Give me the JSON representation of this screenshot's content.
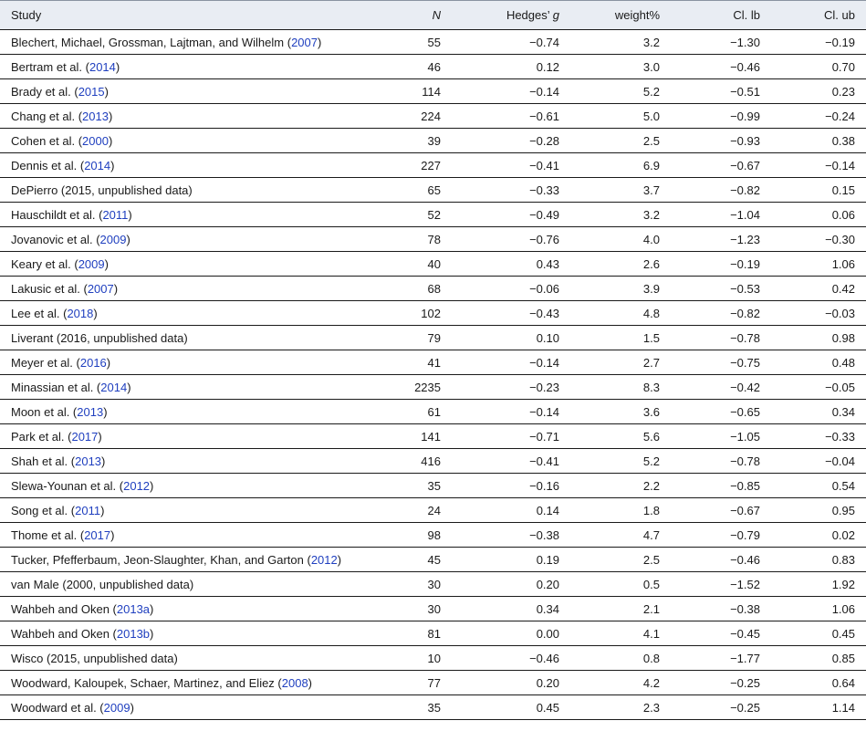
{
  "headers": {
    "study": "Study",
    "n": "N",
    "g_prefix": "Hedges’ ",
    "g_var": "g",
    "weight": "weight%",
    "cl_lb": "Cl. lb",
    "cl_ub": "Cl. ub"
  },
  "rows": [
    {
      "pre": "Blechert, Michael, Grossman, Lajtman, and Wilhelm (",
      "cite": "2007",
      "post": ")",
      "n": "55",
      "g": "−0.74",
      "w": "3.2",
      "lb": "−1.30",
      "ub": "−0.19"
    },
    {
      "pre": "Bertram et al. (",
      "cite": "2014",
      "post": ")",
      "n": "46",
      "g": "0.12",
      "w": "3.0",
      "lb": "−0.46",
      "ub": "0.70"
    },
    {
      "pre": "Brady et al. (",
      "cite": "2015",
      "post": ")",
      "n": "114",
      "g": "−0.14",
      "w": "5.2",
      "lb": "−0.51",
      "ub": "0.23"
    },
    {
      "pre": "Chang et al. (",
      "cite": "2013",
      "post": ")",
      "n": "224",
      "g": "−0.61",
      "w": "5.0",
      "lb": "−0.99",
      "ub": "−0.24"
    },
    {
      "pre": "Cohen et al. (",
      "cite": "2000",
      "post": ")",
      "n": "39",
      "g": "−0.28",
      "w": "2.5",
      "lb": "−0.93",
      "ub": "0.38"
    },
    {
      "pre": "Dennis et al. (",
      "cite": "2014",
      "post": ")",
      "n": "227",
      "g": "−0.41",
      "w": "6.9",
      "lb": "−0.67",
      "ub": "−0.14"
    },
    {
      "pre": "DePierro (2015, unpublished data)",
      "cite": "",
      "post": "",
      "n": "65",
      "g": "−0.33",
      "w": "3.7",
      "lb": "−0.82",
      "ub": "0.15"
    },
    {
      "pre": "Hauschildt et al. (",
      "cite": "2011",
      "post": ")",
      "n": "52",
      "g": "−0.49",
      "w": "3.2",
      "lb": "−1.04",
      "ub": "0.06"
    },
    {
      "pre": "Jovanovic et al. (",
      "cite": "2009",
      "post": ")",
      "n": "78",
      "g": "−0.76",
      "w": "4.0",
      "lb": "−1.23",
      "ub": "−0.30"
    },
    {
      "pre": "Keary et al. (",
      "cite": "2009",
      "post": ")",
      "n": "40",
      "g": "0.43",
      "w": "2.6",
      "lb": "−0.19",
      "ub": "1.06"
    },
    {
      "pre": "Lakusic et al. (",
      "cite": "2007",
      "post": ")",
      "n": "68",
      "g": "−0.06",
      "w": "3.9",
      "lb": "−0.53",
      "ub": "0.42"
    },
    {
      "pre": "Lee et al. (",
      "cite": "2018",
      "post": ")",
      "n": "102",
      "g": "−0.43",
      "w": "4.8",
      "lb": "−0.82",
      "ub": "−0.03"
    },
    {
      "pre": "Liverant (2016, unpublished data)",
      "cite": "",
      "post": "",
      "n": "79",
      "g": "0.10",
      "w": "1.5",
      "lb": "−0.78",
      "ub": "0.98"
    },
    {
      "pre": "Meyer et al. (",
      "cite": "2016",
      "post": ")",
      "n": "41",
      "g": "−0.14",
      "w": "2.7",
      "lb": "−0.75",
      "ub": "0.48"
    },
    {
      "pre": "Minassian et al. (",
      "cite": "2014",
      "post": ")",
      "n": "2235",
      "g": "−0.23",
      "w": "8.3",
      "lb": "−0.42",
      "ub": "−0.05"
    },
    {
      "pre": "Moon et al. (",
      "cite": "2013",
      "post": ")",
      "n": "61",
      "g": "−0.14",
      "w": "3.6",
      "lb": "−0.65",
      "ub": "0.34"
    },
    {
      "pre": "Park et al. (",
      "cite": "2017",
      "post": ")",
      "n": "141",
      "g": "−0.71",
      "w": "5.6",
      "lb": "−1.05",
      "ub": "−0.33"
    },
    {
      "pre": "Shah et al. (",
      "cite": "2013",
      "post": ")",
      "n": "416",
      "g": "−0.41",
      "w": "5.2",
      "lb": "−0.78",
      "ub": "−0.04"
    },
    {
      "pre": "Slewa-Younan et al. (",
      "cite": "2012",
      "post": ")",
      "n": "35",
      "g": "−0.16",
      "w": "2.2",
      "lb": "−0.85",
      "ub": "0.54"
    },
    {
      "pre": "Song et al. (",
      "cite": "2011",
      "post": ")",
      "n": "24",
      "g": "0.14",
      "w": "1.8",
      "lb": "−0.67",
      "ub": "0.95"
    },
    {
      "pre": "Thome et al. (",
      "cite": "2017",
      "post": ")",
      "n": "98",
      "g": "−0.38",
      "w": "4.7",
      "lb": "−0.79",
      "ub": "0.02"
    },
    {
      "pre": "Tucker, Pfefferbaum, Jeon-Slaughter, Khan, and Garton (",
      "cite": "2012",
      "post": ")",
      "n": "45",
      "g": "0.19",
      "w": "2.5",
      "lb": "−0.46",
      "ub": "0.83"
    },
    {
      "pre": "van Male (2000, unpublished data)",
      "cite": "",
      "post": "",
      "n": "30",
      "g": "0.20",
      "w": "0.5",
      "lb": "−1.52",
      "ub": "1.92"
    },
    {
      "pre": "Wahbeh and Oken (",
      "cite": "2013a",
      "post": ")",
      "n": "30",
      "g": "0.34",
      "w": "2.1",
      "lb": "−0.38",
      "ub": "1.06"
    },
    {
      "pre": "Wahbeh and Oken (",
      "cite": "2013b",
      "post": ")",
      "n": "81",
      "g": "0.00",
      "w": "4.1",
      "lb": "−0.45",
      "ub": "0.45"
    },
    {
      "pre": "Wisco (2015, unpublished data)",
      "cite": "",
      "post": "",
      "n": "10",
      "g": "−0.46",
      "w": "0.8",
      "lb": "−1.77",
      "ub": "0.85"
    },
    {
      "pre": "Woodward, Kaloupek, Schaer, Martinez, and Eliez (",
      "cite": "2008",
      "post": ")",
      "n": "77",
      "g": "0.20",
      "w": "4.2",
      "lb": "−0.25",
      "ub": "0.64"
    },
    {
      "pre": "Woodward et al. (",
      "cite": "2009",
      "post": ")",
      "n": "35",
      "g": "0.45",
      "w": "2.3",
      "lb": "−0.25",
      "ub": "1.14"
    }
  ]
}
